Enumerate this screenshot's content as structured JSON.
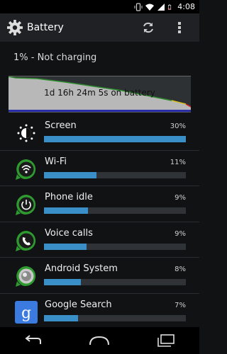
{
  "statusbar": {
    "time": "4:08"
  },
  "actionbar": {
    "title": "Battery"
  },
  "summary": {
    "status": "1% - Not charging",
    "duration": "1d 16h 24m 5s on battery"
  },
  "usage": [
    {
      "name": "Screen",
      "percent": "30%",
      "fraction": 1.0,
      "icon": "brightness-icon"
    },
    {
      "name": "Wi-Fi",
      "percent": "11%",
      "fraction": 0.37,
      "icon": "wifi-app-icon"
    },
    {
      "name": "Phone idle",
      "percent": "9%",
      "fraction": 0.31,
      "icon": "power-app-icon"
    },
    {
      "name": "Voice calls",
      "percent": "9%",
      "fraction": 0.3,
      "icon": "phone-app-icon"
    },
    {
      "name": "Android System",
      "percent": "8%",
      "fraction": 0.26,
      "icon": "android-system-icon"
    },
    {
      "name": "Google Search",
      "percent": "7%",
      "fraction": 0.24,
      "icon": "google-search-icon"
    }
  ],
  "colors": {
    "bar": "#3a8fc8",
    "graph_fill": "#b8b8b8",
    "graph_line": "#2e8b2e"
  }
}
